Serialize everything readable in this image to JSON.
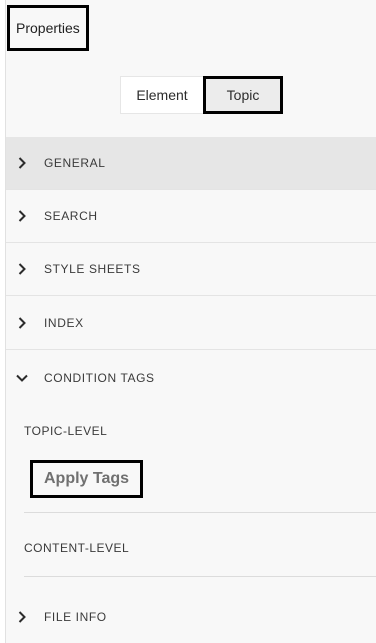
{
  "panel": {
    "title": "Properties"
  },
  "toggle": {
    "options": [
      "Element",
      "Topic"
    ],
    "selected": "Topic"
  },
  "sections": [
    {
      "label": "GENERAL",
      "expanded": false,
      "active": true
    },
    {
      "label": "SEARCH",
      "expanded": false
    },
    {
      "label": "STYLE SHEETS",
      "expanded": false
    },
    {
      "label": "INDEX",
      "expanded": false
    },
    {
      "label": "CONDITION TAGS",
      "expanded": true
    },
    {
      "label": "FILE INFO",
      "expanded": false
    }
  ],
  "condition_tags": {
    "topic_level_label": "TOPIC-LEVEL",
    "apply_tags_label": "Apply Tags",
    "content_level_label": "CONTENT-LEVEL"
  },
  "icons": {
    "collapsed": "chevron-right-icon",
    "expanded": "chevron-down-icon"
  },
  "colors": {
    "panel_bg": "#f8f8f8",
    "active_row_bg": "#e6e6e6",
    "selected_toggle_bg": "#ececec",
    "highlight_border": "#000000"
  }
}
